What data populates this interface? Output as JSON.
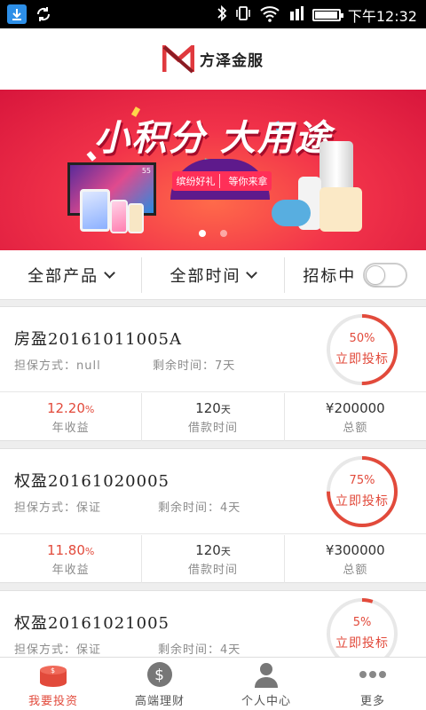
{
  "statusbar": {
    "time": "下午12:32",
    "battery_level": 0.9
  },
  "header": {
    "brand": "方泽金服"
  },
  "banner": {
    "title": "小积分 大用途",
    "pill_left": "缤纷好礼",
    "pill_right": "等你来拿",
    "tv_label": "55",
    "active_slide": 1,
    "slide_count": 2
  },
  "filters": {
    "product": "全部产品",
    "time": "全部时间",
    "status": "招标中",
    "status_toggle_on": false
  },
  "labels": {
    "guarantee": "担保方式：",
    "remaining": "剩余时间：",
    "invest_button": "立即投标",
    "annual_rate": "年收益",
    "loan_term": "借款时间",
    "total": "总额",
    "day_unit": "天"
  },
  "products": [
    {
      "name": "房盈20161011005A",
      "guarantee": "null",
      "remaining": "7天",
      "progress_text": "50%",
      "progress": 0.5,
      "rate": "12.20",
      "rate_unit": "%",
      "term": "120",
      "amount": "¥200000"
    },
    {
      "name": "权盈20161020005",
      "guarantee": "保证",
      "remaining": "4天",
      "progress_text": "75%",
      "progress": 0.75,
      "rate": "11.80",
      "rate_unit": "%",
      "term": "120",
      "amount": "¥300000"
    },
    {
      "name": "权盈20161021005",
      "guarantee": "保证",
      "remaining": "4天",
      "progress_text": "5%",
      "progress": 0.05,
      "rate": "",
      "rate_unit": "",
      "term": "",
      "amount": ""
    }
  ],
  "nav": [
    {
      "label": "我要投资",
      "icon": "coin-stack-icon",
      "active": true
    },
    {
      "label": "高端理财",
      "icon": "dollar-circle-icon",
      "active": false
    },
    {
      "label": "个人中心",
      "icon": "person-icon",
      "active": false
    },
    {
      "label": "更多",
      "icon": "more-dots-icon",
      "active": false
    }
  ],
  "colors": {
    "accent": "#e24a3b",
    "banner": "#f2334a"
  }
}
